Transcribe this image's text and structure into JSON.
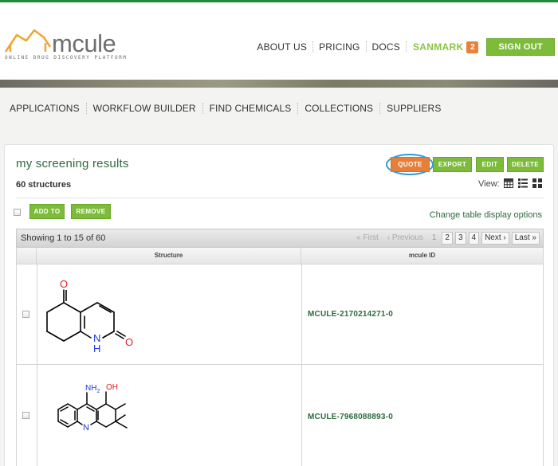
{
  "brand": {
    "name": "mcule",
    "tagline": "ONLINE DRUG DISCOVERY PLATFORM"
  },
  "top_nav": {
    "links": [
      "ABOUT US",
      "PRICING",
      "DOCS"
    ],
    "user": "SANMARK",
    "notifications": "2",
    "sign_out": "SIGN OUT"
  },
  "main_nav": [
    "APPLICATIONS",
    "WORKFLOW BUILDER",
    "FIND CHEMICALS",
    "COLLECTIONS",
    "SUPPLIERS"
  ],
  "panel": {
    "title": "my screening results",
    "count": "60 structures",
    "actions": {
      "quote": "QUOTE",
      "export": "EXPORT",
      "edit": "EDIT",
      "delete": "DELETE"
    },
    "view_label": "View:",
    "view_icons": [
      "grid-view-icon",
      "list-view-icon",
      "tile-view-icon"
    ],
    "bulk": {
      "add_to": "ADD TO",
      "remove": "REMOVE"
    },
    "change_table_options": "Change table display options"
  },
  "table": {
    "showing": "Showing 1 to 15 of 60",
    "pager": {
      "first": "« First",
      "previous": "‹ Previous",
      "pages": [
        "1",
        "2",
        "3",
        "4"
      ],
      "current": "1",
      "next": "Next ›",
      "last": "Last »"
    },
    "columns": [
      "Structure",
      "mcule ID"
    ],
    "rows": [
      {
        "id": "MCULE-2170214271-0",
        "atom_labels": {
          "oxygen_top": "O",
          "oxygen_right": "O",
          "nitrogen": "N",
          "hydrogen": "H"
        }
      },
      {
        "id": "MCULE-7968088893-0",
        "atom_labels": {
          "amine": "NH",
          "amine_sub": "2",
          "hydroxyl": "OH",
          "nitrogen": "N"
        }
      }
    ]
  },
  "colors": {
    "accent_green": "#7dbb3a",
    "brand_green": "#2d6a3c",
    "quote_orange": "#e57f3a",
    "highlight_ring": "#2a9bd7",
    "logo_orange": "#f0a535"
  }
}
